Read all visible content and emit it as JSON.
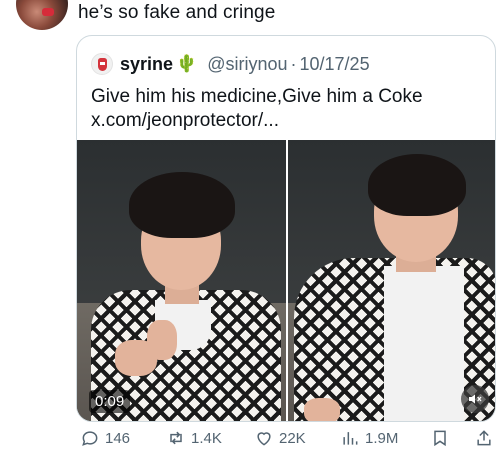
{
  "reply": {
    "text": "he’s so fake and cringe"
  },
  "quoted_tweet": {
    "display_name": "syrine",
    "name_emoji": "🌵",
    "handle": "@siriynou",
    "separator": "·",
    "date": "10/17/25",
    "text_line1": "Give him his medicine,Give him a Coke",
    "text_line2": "x.com/jeonprotector/...",
    "video_time": "0:09"
  },
  "actions": {
    "replies": "146",
    "reposts": "1.4K",
    "likes": "22K",
    "views": "1.9M"
  },
  "icons": [
    "avatar",
    "reply-icon",
    "repost-icon",
    "like-icon",
    "views-icon",
    "bookmark-icon",
    "share-icon",
    "mute-icon"
  ],
  "colors": {
    "text_primary": "#0f1419",
    "text_secondary": "#536471",
    "border": "#cfd9de"
  }
}
